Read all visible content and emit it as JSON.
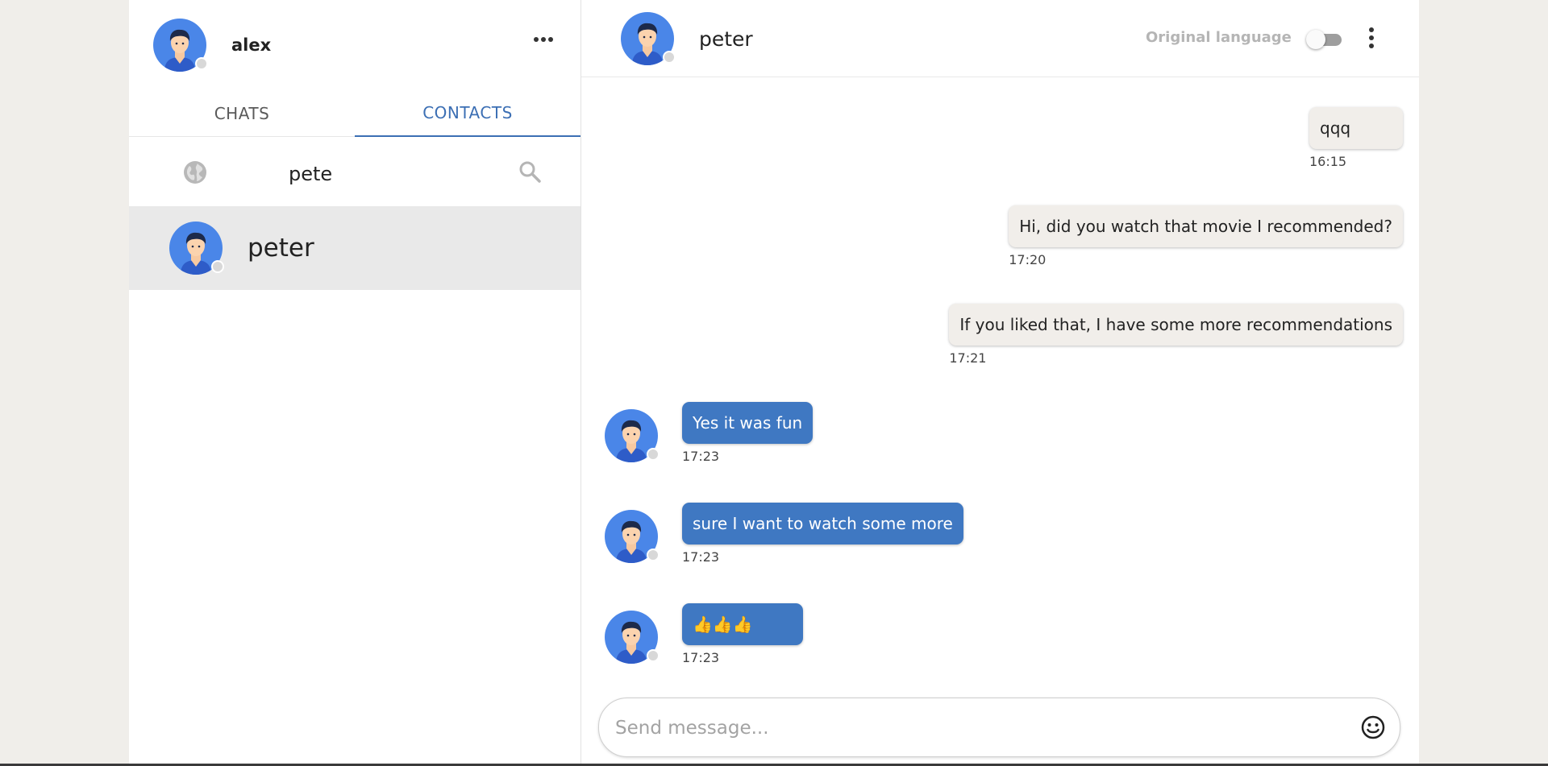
{
  "sidebar": {
    "user_name": "alex",
    "tabs": [
      {
        "label": "CHATS",
        "active": false
      },
      {
        "label": "CONTACTS",
        "active": true
      }
    ],
    "search_value": "pete",
    "contacts": [
      {
        "name": "peter"
      }
    ]
  },
  "chat": {
    "peer_name": "peter",
    "original_language_label": "Original language",
    "original_language_on": false,
    "composer_placeholder": "Send message...",
    "messages": [
      {
        "dir": "out",
        "text": "qqq",
        "time": "16:15"
      },
      {
        "dir": "out",
        "text": "Hi, did you watch that movie I recommended?",
        "time": "17:20"
      },
      {
        "dir": "out",
        "text": "If you liked that, I have some more recommendations",
        "time": "17:21"
      },
      {
        "dir": "in",
        "text": "Yes it was fun",
        "time": "17:23"
      },
      {
        "dir": "in",
        "text": "sure I want to watch some more",
        "time": "17:23"
      },
      {
        "dir": "in",
        "text": "👍👍👍",
        "time": "17:23"
      }
    ]
  },
  "colors": {
    "accent": "#3c6fb4",
    "incoming_bubble": "#3f78c2",
    "outgoing_bubble": "#f1eeea",
    "avatar_bg": "#4a86e8",
    "page_bg": "#f0eeea"
  },
  "icons": [
    "more-horizontal-icon",
    "globe-icon",
    "search-icon",
    "more-vertical-icon",
    "emoji-icon",
    "avatar-icon"
  ]
}
